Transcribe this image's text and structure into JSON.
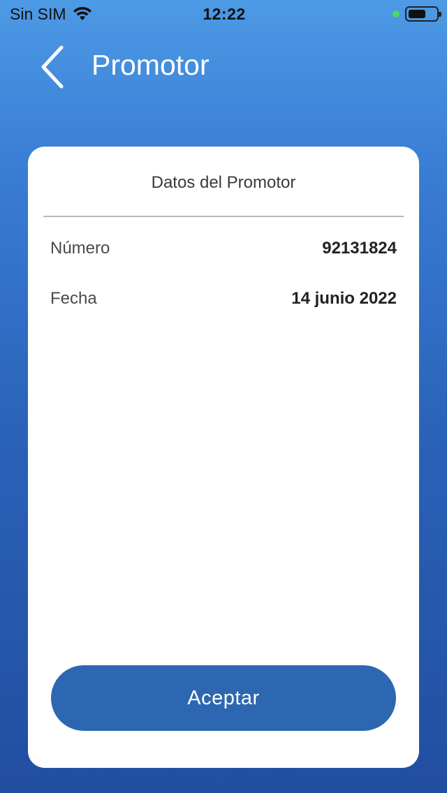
{
  "status_bar": {
    "carrier": "Sin SIM",
    "time": "12:22",
    "wifi_icon": "wifi-icon",
    "battery_icon": "battery-icon",
    "indicator_color": "#4cd964"
  },
  "nav": {
    "back_icon": "chevron-left-icon",
    "title": "Promotor"
  },
  "card": {
    "title": "Datos del Promotor",
    "rows": [
      {
        "label": "Número",
        "value": "92131824"
      },
      {
        "label": "Fecha",
        "value": "14 junio 2022"
      }
    ],
    "accept_label": "Aceptar"
  },
  "colors": {
    "background_top": "#4d9ae5",
    "background_bottom": "#224ea0",
    "button": "#2d67b2",
    "card": "#ffffff"
  }
}
